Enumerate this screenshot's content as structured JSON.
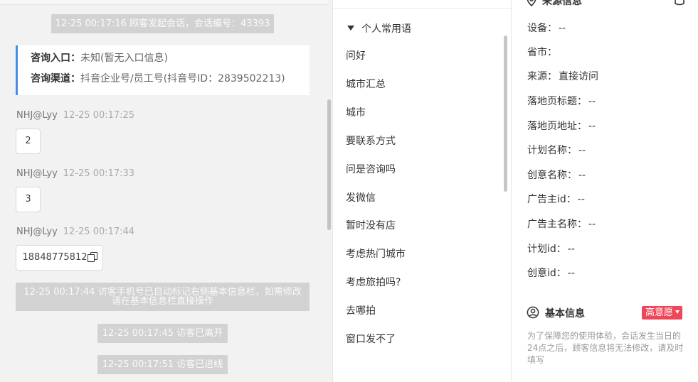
{
  "chat": {
    "session_start": "12-25 00:17:16 顾客发起会话，会话编号：43393",
    "entry": {
      "entrance_label": "咨询入口：",
      "entrance_value": "未知(暂无入口信息)",
      "channel_label": "咨询渠道：",
      "channel_value": "抖音企业号/员工号(抖音号ID：2839502213)"
    },
    "messages": [
      {
        "sender": "NHJ@Lyy",
        "time": "12-25 00:17:25",
        "text": "2"
      },
      {
        "sender": "NHJ@Lyy",
        "time": "12-25 00:17:33",
        "text": "3"
      },
      {
        "sender": "NHJ@Lyy",
        "time": "12-25 00:17:44",
        "text": "18848775812"
      }
    ],
    "notice_auto_mark": "12-25 00:17:44 访客手机号已自动标记右侧基本信息栏，如需修改请在基本信息栏直接操作",
    "notice_left": "12-25 00:17:45 访客已离开",
    "notice_entered": "12-25 00:17:51 访客已进线"
  },
  "phrases": {
    "group_title": "个人常用语",
    "items": [
      "问好",
      "城市汇总",
      "城市",
      "要联系方式",
      "问是咨询吗",
      "发微信",
      "暂时没有店",
      "考虑热门城市",
      "考虑旅拍吗?",
      "去哪拍",
      "窗口发不了"
    ]
  },
  "info": {
    "source_title": "来源信息",
    "source_rows": [
      {
        "label": "设备：",
        "value": "--"
      },
      {
        "label": "省市：",
        "value": ""
      },
      {
        "label": "来源：",
        "value": "直接访问"
      },
      {
        "label": "落地页标题：",
        "value": "--"
      },
      {
        "label": "落地页地址：",
        "value": "--"
      },
      {
        "label": "计划名称：",
        "value": "--"
      },
      {
        "label": "创意名称：",
        "value": "--"
      },
      {
        "label": "广告主id：",
        "value": "--"
      },
      {
        "label": "广告主名称：",
        "value": "--"
      },
      {
        "label": "计划id：",
        "value": "--"
      },
      {
        "label": "创意id：",
        "value": "--"
      }
    ],
    "basic_title": "基本信息",
    "intent_badge": "高意愿",
    "note": "为了保障您的使用体验，会话发生当日的24点之后，顾客信息将无法修改，请及时填写"
  },
  "colors": {
    "accent_blue": "#4a8be6",
    "badge_red": "#f04659",
    "system_pill_bg": "#d2d2d2"
  },
  "icons": [
    "location-pin-icon",
    "edit-icon",
    "user-circle-icon",
    "copy-icon",
    "caret-down-icon"
  ]
}
